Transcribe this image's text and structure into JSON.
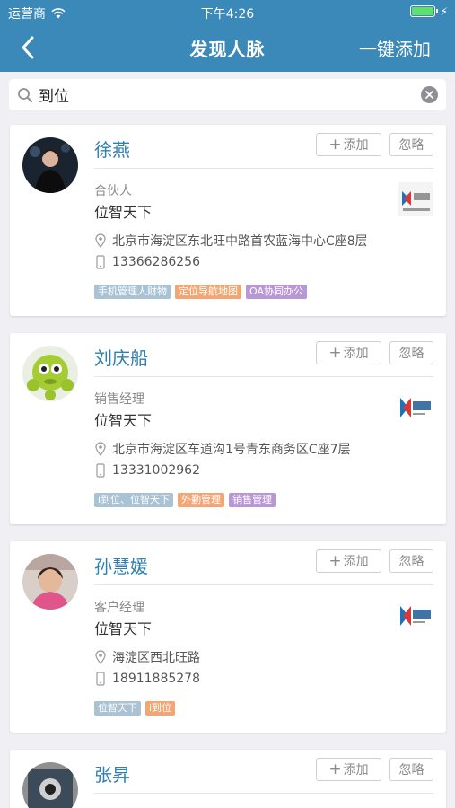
{
  "status_bar": {
    "carrier": "运营商",
    "time": "下午4:26"
  },
  "nav": {
    "title": "发现人脉",
    "add_all": "一键添加"
  },
  "search": {
    "value": "到位"
  },
  "buttons": {
    "add": "添加",
    "ignore": "忽略"
  },
  "contacts": [
    {
      "name": "徐燕",
      "role": "合伙人",
      "company": "位智天下",
      "address": "北京市海淀区东北旺中路首农蓝海中心C座8层",
      "phone": "13366286256",
      "tags": [
        {
          "label": "手机管理人财物",
          "color": "blue"
        },
        {
          "label": "定位导航地图",
          "color": "orange"
        },
        {
          "label": "OA协同办公",
          "color": "purple"
        }
      ]
    },
    {
      "name": "刘庆船",
      "role": "销售经理",
      "company": "位智天下",
      "address": "北京市海淀区车道沟1号青东商务区C座7层",
      "phone": "13331002962",
      "tags": [
        {
          "label": "i到位、位智天下",
          "color": "blue"
        },
        {
          "label": "外勤管理",
          "color": "orange"
        },
        {
          "label": "销售管理",
          "color": "purple"
        }
      ]
    },
    {
      "name": "孙慧媛",
      "role": "客户经理",
      "company": "位智天下",
      "address": "海淀区西北旺路",
      "phone": "18911885278",
      "tags": [
        {
          "label": "位智天下",
          "color": "blue"
        },
        {
          "label": "i到位",
          "color": "orange"
        }
      ]
    },
    {
      "name": "张昇"
    }
  ],
  "colors": {
    "nav_bg": "#3a89b9",
    "name_text": "#2f7fb1",
    "tag_blue": "#a9c2d4",
    "tag_orange": "#f3a574",
    "tag_purple": "#b997d6",
    "page_bg": "#efeff4"
  }
}
